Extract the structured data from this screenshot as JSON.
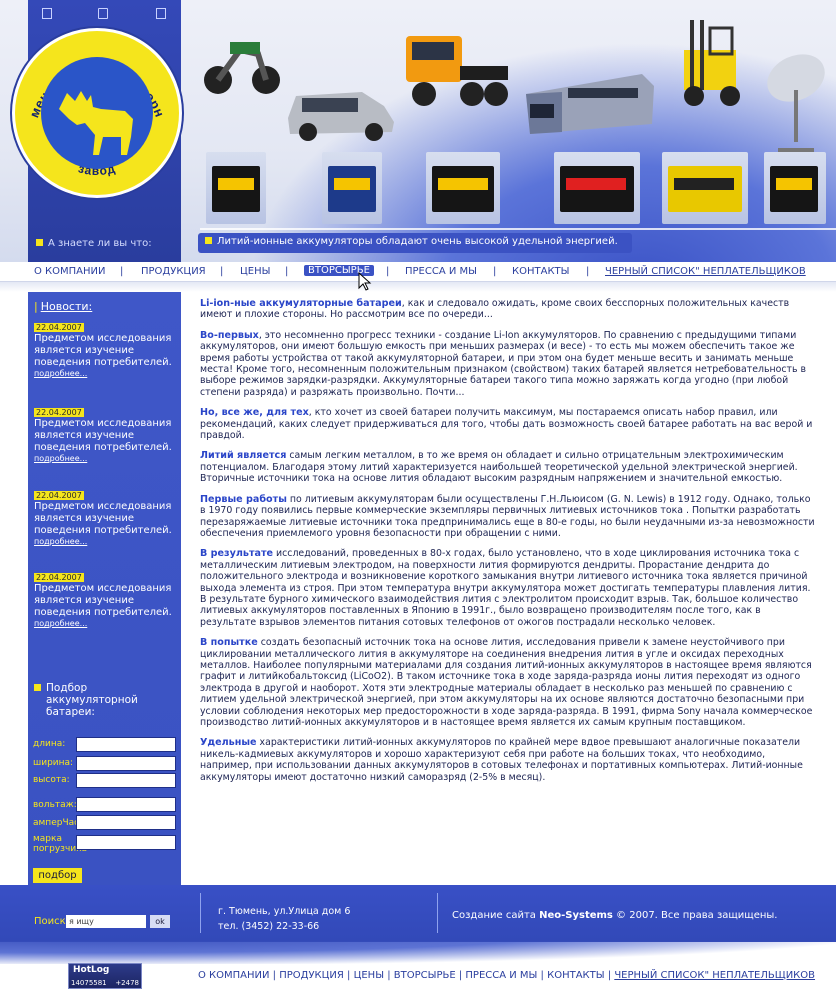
{
  "header": {
    "logo": {
      "text_top": "Тюменский аккумуляторный",
      "text_bottom": "завод"
    },
    "did_you_know_label": "А знаете ли вы что:",
    "ticker_text": "Литий-ионные аккумуляторы обладают очень высокой удельной энергией."
  },
  "top_nav": {
    "items": [
      "О КОМПАНИИ",
      "ПРОДУКЦИЯ",
      "ЦЕНЫ",
      "ВТОРСЫРЬЕ",
      "ПРЕССА И МЫ",
      "КОНТАКТЫ",
      "ЧЕРНЫЙ СПИСОК\" НЕПЛАТЕЛЬЩИКОВ"
    ],
    "separator": "|",
    "active": "ВТОРСЫРЬЕ"
  },
  "sidebar": {
    "news_title": "Новости:",
    "news_bar": "|",
    "news": [
      {
        "date": "22.04.2007",
        "text": "Предметом исследования является изучение поведения потребителей.",
        "more": "подробнее..."
      },
      {
        "date": "22.04.2007",
        "text": "Предметом исследования является изучение поведения потребителей.",
        "more": "подробнее..."
      },
      {
        "date": "22.04.2007",
        "text": "Предметом исследования является изучение поведения потребителей.",
        "more": "подробнее..."
      },
      {
        "date": "22.04.2007",
        "text": "Предметом исследования является изучение поведения потребителей.",
        "more": "подробнее..."
      }
    ],
    "picker": {
      "title": "Подбор аккумуляторной батареи:",
      "fields": [
        {
          "label": "длина:",
          "value": ""
        },
        {
          "label": "ширина:",
          "value": ""
        },
        {
          "label": "высота:",
          "value": ""
        },
        {
          "label": "вольтаж:",
          "value": ""
        },
        {
          "label": "амперЧас",
          "value": ""
        },
        {
          "label": "марка погрузчика",
          "value": ""
        }
      ],
      "button": "подбор"
    }
  },
  "main": {
    "paragraphs": [
      {
        "lead": "Li-ion-ные аккумуляторные батареи",
        "text": ", как и следовало ожидать, кроме своих бесспорных положительных качеств имеют и плохие стороны. Но рассмотрим все по очереди..."
      },
      {
        "lead": "Во-первых",
        "text": ", это несомненно прогресс техники - создание Li-Ion аккумуляторов. По сравнению с предыдущими типами аккумуляторов, они имеют большую емкость при меньших размерах (и весе) - то есть мы можем обеспечить такое же время работы устройства от такой аккумуляторной  батареи, и при этом она будет меньше весить и занимать меньше места! Кроме того, несомненным положительным признаком (свойством) таких батарей является нетребовательность в выборе режимов зарядки-разрядки. Аккумуляторные батареи такого типа можно заряжать когда угодно (при любой степени разряда) и разряжать произвольно. Почти..."
      },
      {
        "lead": "Но, все же, для тех",
        "text": ", кто хочет из своей батареи получить максимум, мы постараемся описать набор правил, или рекомендаций, каких следует придерживаться для того, чтобы дать возможность своей батарее работать на вас верой и правдой."
      },
      {
        "lead": "Литий является",
        "text": " самым легким металлом, в то же время он обладает и сильно отрицательным электрохимическим потенциалом. Благодаря этому литий характеризуется наибольшей теоретической удельной электрической энергией. Вторичные источники тока на основе лития обладают высоким разрядным напряжением и значительной емкостью."
      },
      {
        "lead": "Первые работы",
        "text": " по литиевым аккумуляторам были осуществлены Г.Н.Льюисом (G. N. Lewis) в 1912 году. Однако, только в 1970 году появились первые коммерческие экземпляры первичных литиевых источников тока . Попытки разработать перезаряжаемые литиевые источники тока предпринимались еще в 80-е годы, но были неудачными из-за невозможности обеспечения приемлемого уровня безопасности при обращении с ними."
      },
      {
        "lead": "В результате",
        "text": " исследований, проведенных в 80-х годах, было установлено, что в ходе циклирования источника тока с металлическим литиевым электродом, на поверхности лития формируются дендриты. Прорастание дендрита до положительного электрода и возникновение короткого замыкания внутри литиевого источника тока является причиной выхода элемента из строя. При этом температура внутри аккумулятора может достигать температуры плавления лития. В результате бурного химического взаимодействия лития с электролитом происходит взрыв. Так, большое количество литиевых аккумуляторов поставленных в Японию в 1991г., было возвращено производителям после того, как в результате взрывов элементов питания сотовых телефонов от ожогов пострадали несколько человек."
      },
      {
        "lead": "В попытке",
        "text": " создать безопасный источник тока на основе лития, исследования привели к замене неустойчивого при циклировании металлического лития в аккумуляторе на соединения внедрения лития в угле и оксидах переходных металлов. Наиболее популярными материалами для создания литий-ионных аккумуляторов в настоящее время являются графит и литийкобальтоксид (LiCoO2). В таком источнике тока в ходе заряда-разряда ионы лития переходят из одного электрода в другой и наоборот. Хотя эти электродные материалы обладает в несколько раз меньшей по сравнению с литием удельной электрической энергией, при этом аккумуляторы на их основе являются достаточно безопасными при условии соблюдения некоторых мер предосторожности в ходе заряда-разряда. В 1991, фирма Sony начала коммерческое производство литий-ионных аккумуляторов и в настоящее время является их самым крупным поставщиком."
      },
      {
        "lead": "Удельные",
        "text": " характеристики литий-ионных аккумуляторов по крайней мере вдвое превышают аналогичные показатели никель-кадмиевых аккумуляторов и хорошо характеризуют себя при работе на больших токах, что необходимо, например, при использовании данных аккумуляторов в сотовых телефонах и портативных компьютерах. Литий-ионные аккумуляторы имеют достаточно низкий саморазряд (2-5% в месяц)."
      }
    ]
  },
  "footer": {
    "search_label": "Поиск",
    "search_value": "я ищу",
    "ok_label": "ok",
    "address": "г. Тюмень, ул.Улица дом 6",
    "phone": "тел. (3452) 22-33-66",
    "copyright_prefix": "Создание сайта ",
    "copyright_brand": "Neo-Systems",
    "copyright_suffix": " © 2007. Все права защищены.",
    "counter": {
      "brand": "HotLog",
      "n1": "14075581",
      "n2": "+2478"
    },
    "bottom_nav": [
      "О КОМПАНИИ",
      "ПРОДУКЦИЯ",
      "ЦЕНЫ",
      "ВТОРСЫРЬЕ",
      "ПРЕССА И МЫ",
      "КОНТАКТЫ",
      "ЧЕРНЫЙ СПИСОК\" НЕПЛАТЕЛЬЩИКОВ"
    ]
  },
  "colors": {
    "brand_blue": "#3a52c4",
    "accent_yellow": "#f5e51c",
    "link_blue": "#2a3e9e"
  }
}
